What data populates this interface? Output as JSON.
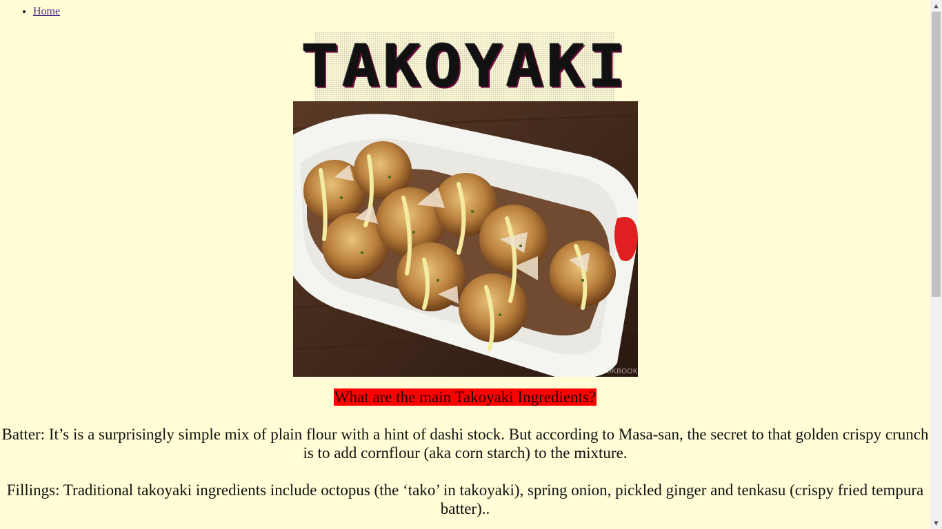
{
  "nav": {
    "items": [
      {
        "label": "Home"
      }
    ]
  },
  "logo": {
    "text": "TAKOYAKI"
  },
  "photo": {
    "watermark": "JUSTONECOOKBOOK",
    "alt": "takoyaki-photo"
  },
  "section": {
    "heading": "What are the main Takoyaki Ingredients?",
    "paragraphs": [
      "Batter: It’s is a surprisingly simple mix of plain flour with a hint of dashi stock. But according to Masa-san, the secret to that golden crispy crunch is to add cornflour (aka corn starch) to the mixture.",
      "Fillings: Traditional takoyaki ingredients include octopus (the ‘tako’ in takoyaki), spring onion, pickled ginger and tenkasu (crispy fried tempura batter).."
    ]
  },
  "colors": {
    "background": "#fffcd6",
    "heading_highlight": "#ff0000",
    "link": "#4b2a8c"
  }
}
